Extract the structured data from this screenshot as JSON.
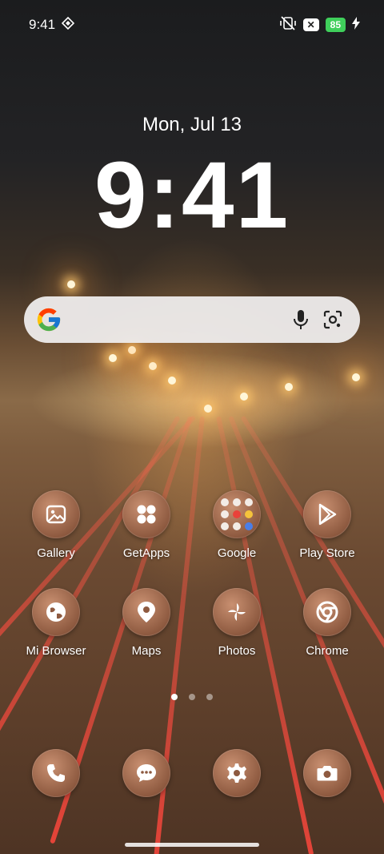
{
  "status": {
    "time": "9:41",
    "battery": "85"
  },
  "lockclock": {
    "date": "Mon, Jul 13",
    "time": "9:41"
  },
  "search": {
    "logo_icon": "google-g-icon",
    "mic_icon": "microphone-icon",
    "lens_icon": "google-lens-icon"
  },
  "apps": [
    {
      "label": "Gallery",
      "icon": "gallery-icon"
    },
    {
      "label": "GetApps",
      "icon": "getapps-icon"
    },
    {
      "label": "Google",
      "icon": "folder-icon"
    },
    {
      "label": "Play Store",
      "icon": "play-store-icon"
    },
    {
      "label": "Mi Browser",
      "icon": "globe-icon"
    },
    {
      "label": "Maps",
      "icon": "map-pin-icon"
    },
    {
      "label": "Photos",
      "icon": "pinwheel-icon"
    },
    {
      "label": "Chrome",
      "icon": "chrome-icon"
    }
  ],
  "pages": {
    "count": 3,
    "active": 0
  },
  "dock": [
    {
      "icon": "phone-icon"
    },
    {
      "icon": "message-icon"
    },
    {
      "icon": "settings-icon"
    },
    {
      "icon": "camera-icon"
    }
  ],
  "colors": {
    "battery": "#3fcf5b",
    "icon_bg": "#8e5a40",
    "search_bg": "#eeecec"
  }
}
